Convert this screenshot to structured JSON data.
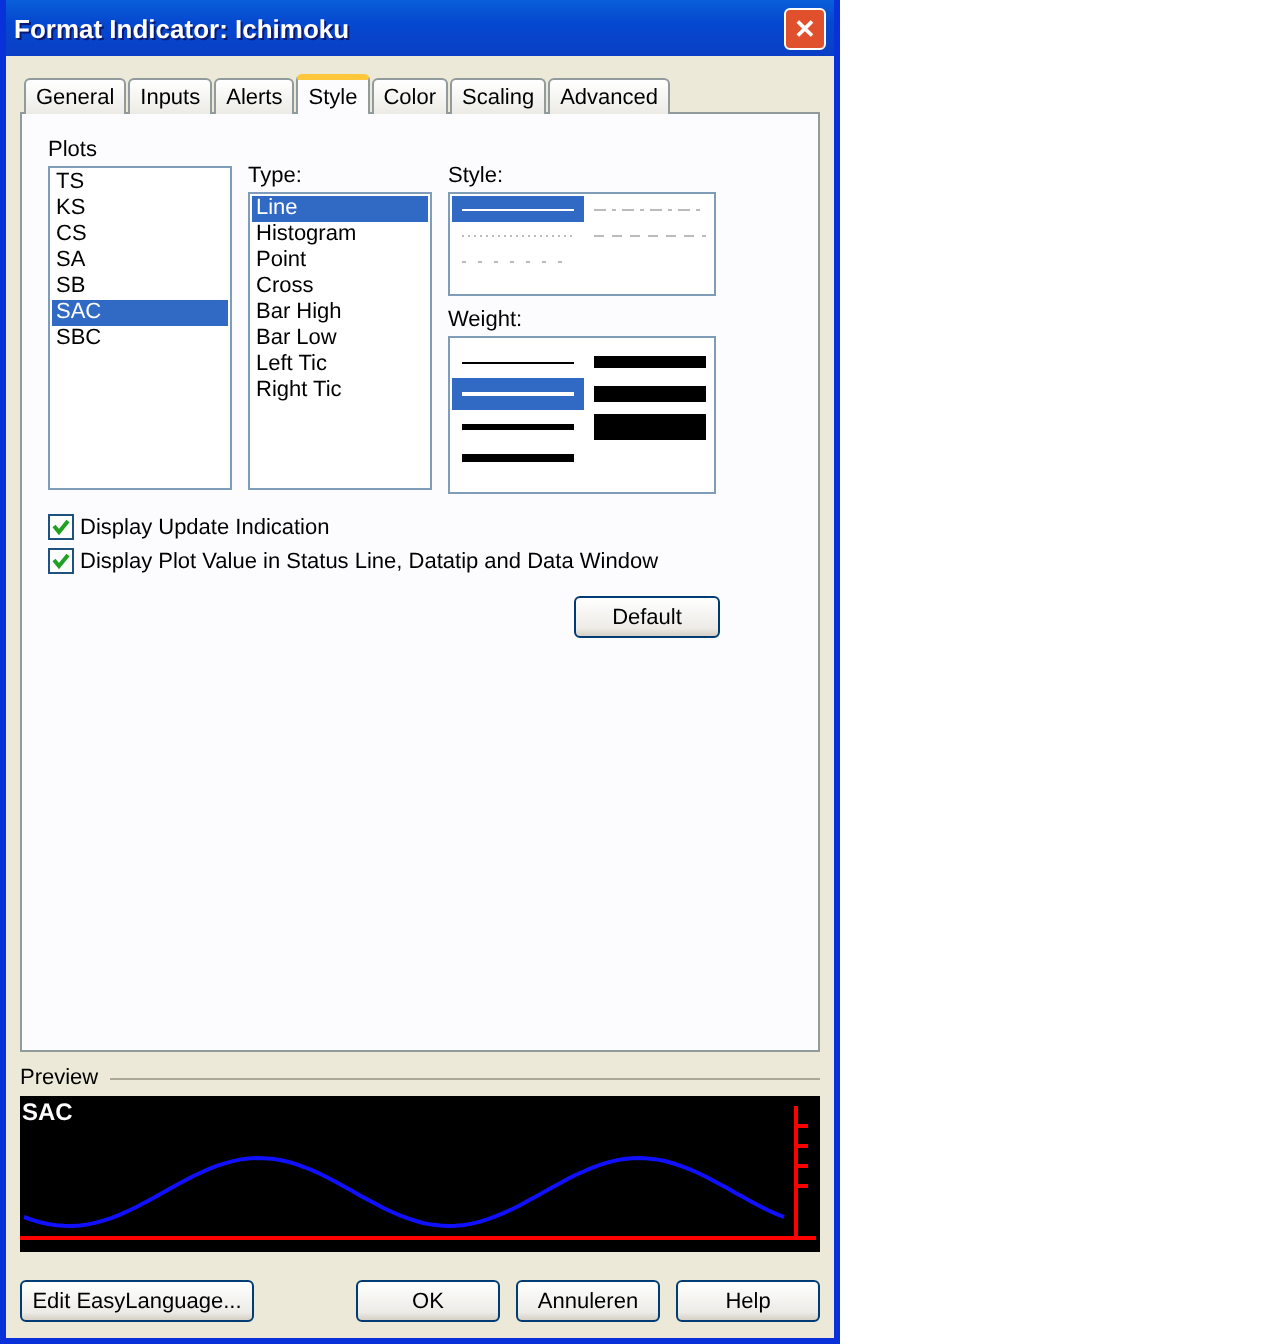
{
  "window": {
    "title": "Format Indicator: Ichimoku",
    "close": "✕"
  },
  "tabs": [
    {
      "label": "General",
      "selected": false
    },
    {
      "label": "Inputs",
      "selected": false
    },
    {
      "label": "Alerts",
      "selected": false
    },
    {
      "label": "Style",
      "selected": true
    },
    {
      "label": "Color",
      "selected": false
    },
    {
      "label": "Scaling",
      "selected": false
    },
    {
      "label": "Advanced",
      "selected": false
    }
  ],
  "plots": {
    "label": "Plots",
    "items": [
      {
        "label": "TS",
        "selected": false
      },
      {
        "label": "KS",
        "selected": false
      },
      {
        "label": "CS",
        "selected": false
      },
      {
        "label": "SA",
        "selected": false
      },
      {
        "label": "SB",
        "selected": false
      },
      {
        "label": "SAC",
        "selected": true
      },
      {
        "label": "SBC",
        "selected": false
      }
    ]
  },
  "type": {
    "label": "Type:",
    "items": [
      {
        "label": "Line",
        "selected": true
      },
      {
        "label": "Histogram",
        "selected": false
      },
      {
        "label": "Point",
        "selected": false
      },
      {
        "label": "Cross",
        "selected": false
      },
      {
        "label": "Bar High",
        "selected": false
      },
      {
        "label": "Bar Low",
        "selected": false
      },
      {
        "label": "Left Tic",
        "selected": false
      },
      {
        "label": "Right Tic",
        "selected": false
      }
    ]
  },
  "style": {
    "label": "Style:",
    "items": [
      {
        "kind": "solid",
        "selected": true
      },
      {
        "kind": "dashdot",
        "selected": false
      },
      {
        "kind": "dotted",
        "selected": false
      },
      {
        "kind": "dashed",
        "selected": false
      },
      {
        "kind": "sparse",
        "selected": false
      }
    ]
  },
  "weight": {
    "label": "Weight:",
    "items": [
      {
        "kind": "w1",
        "selected": false
      },
      {
        "kind": "w2",
        "selected": true
      },
      {
        "kind": "w3",
        "selected": false
      },
      {
        "kind": "w4",
        "selected": false
      },
      {
        "kind": "w5",
        "selected": false
      },
      {
        "kind": "w6",
        "selected": false
      },
      {
        "kind": "w7",
        "selected": false
      }
    ]
  },
  "options": [
    {
      "label": "Display Update Indication",
      "checked": true
    },
    {
      "label": "Display Plot Value in Status Line, Datatip and Data Window",
      "checked": true
    }
  ],
  "default_button": "Default",
  "preview": {
    "label": "Preview",
    "plot_name": "SAC"
  },
  "buttons": [
    "Edit EasyLanguage...",
    "OK",
    "Annuleren",
    "Help"
  ]
}
